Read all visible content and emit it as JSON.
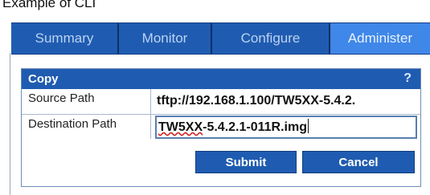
{
  "caption": "Example of CLI",
  "tabs": [
    {
      "label": "Summary"
    },
    {
      "label": "Monitor"
    },
    {
      "label": "Configure"
    },
    {
      "label": "Administer",
      "active": true
    }
  ],
  "panel": {
    "title": "Copy",
    "help": "?"
  },
  "form": {
    "source_label": "Source Path",
    "source_value": "tftp://192.168.1.100/TW5XX-5.4.2.",
    "destination_label": "Destination Path",
    "destination_value_prefix": "TW5XX",
    "destination_value_rest": "-5.4.2.1-011R.img"
  },
  "buttons": {
    "submit": "Submit",
    "cancel": "Cancel"
  },
  "colors": {
    "nav_bg": "#1f5cb1",
    "tab_active_bg": "#3f87e8"
  }
}
